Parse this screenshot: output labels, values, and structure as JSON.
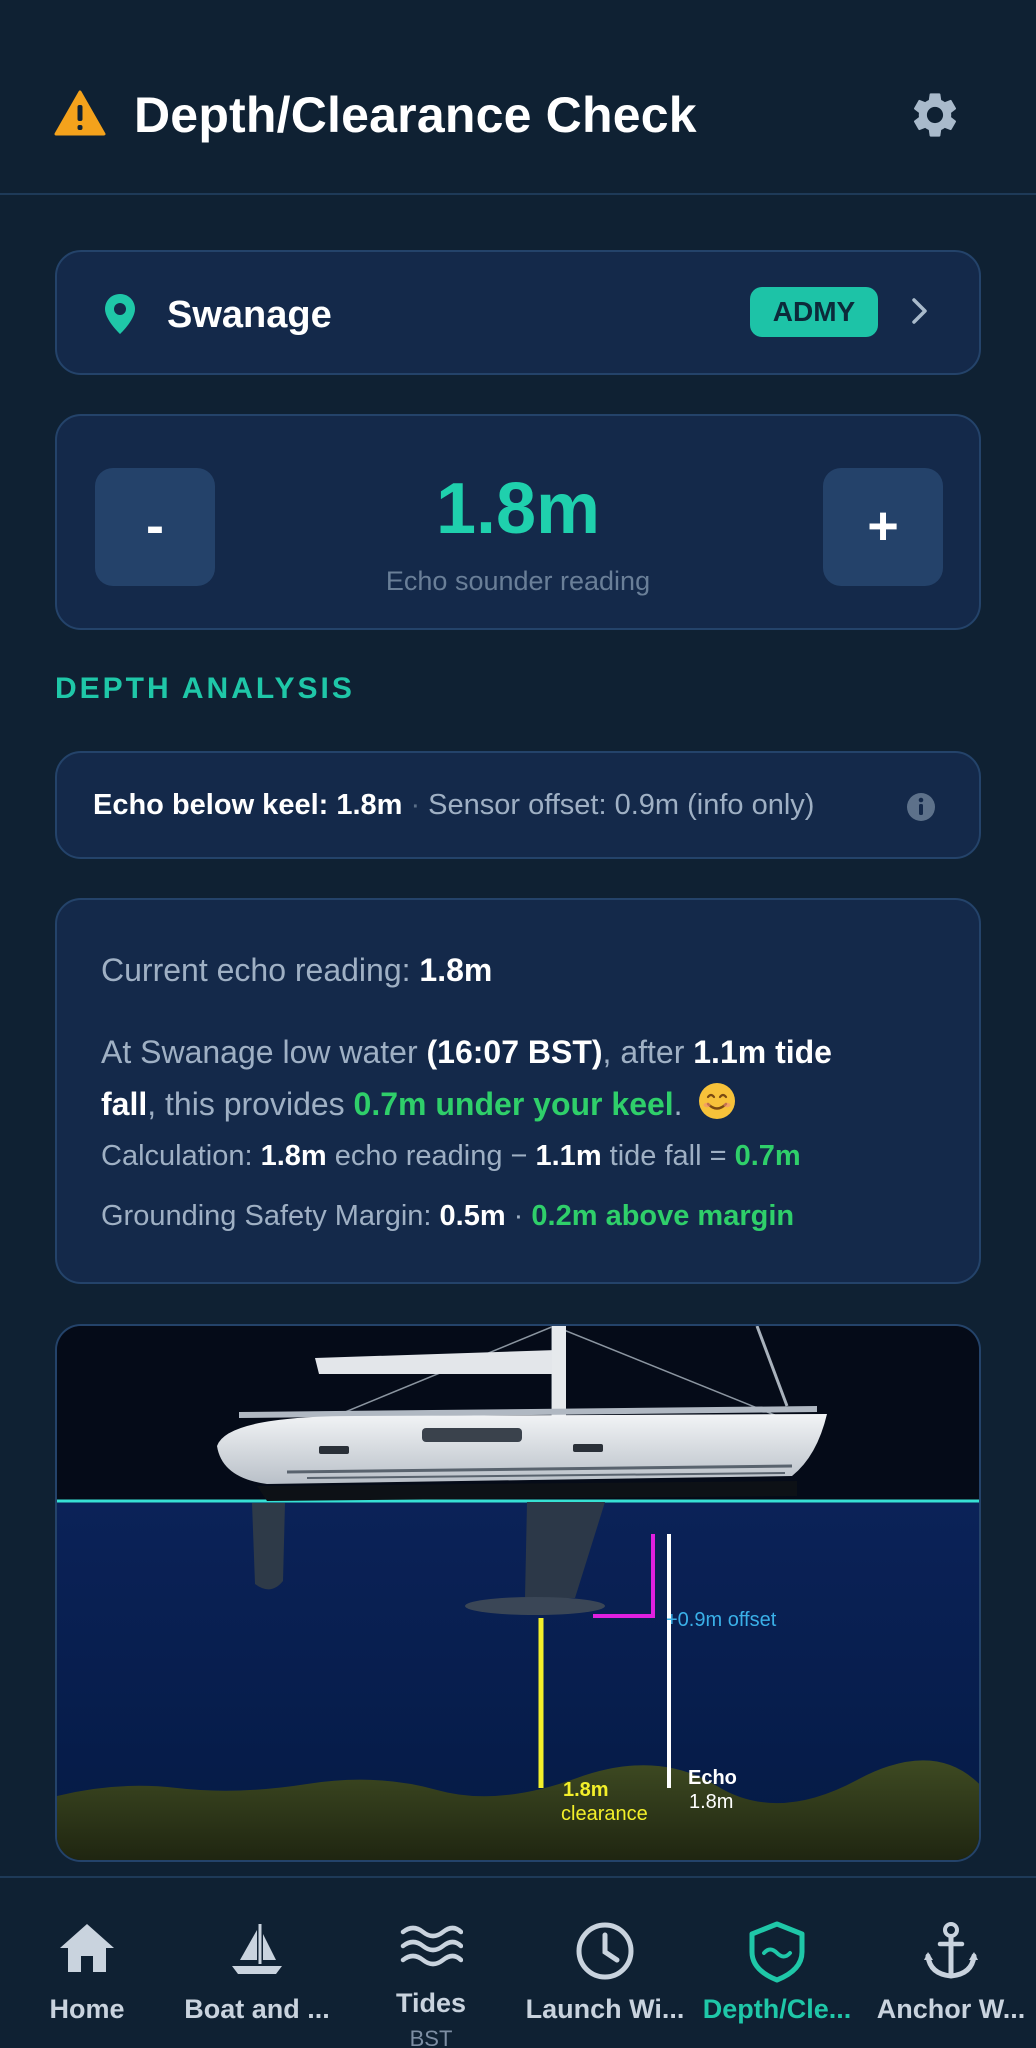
{
  "header": {
    "title": "Depth/Clearance Check",
    "warning_icon": "warning-triangle-icon",
    "settings_icon": "gear-icon"
  },
  "location": {
    "name": "Swanage",
    "badge": "ADMY"
  },
  "reading": {
    "minus_label": "-",
    "plus_label": "+",
    "value": "1.8m",
    "caption": "Echo sounder reading"
  },
  "section_title": "DEPTH ANALYSIS",
  "offset_row": {
    "echo_label": "Echo below keel: 1.8m",
    "sensor_text": "Sensor offset: 0.9m (info only)"
  },
  "analysis": {
    "current_label": "Current echo reading: ",
    "current_value": "1.8m",
    "lw_prefix": "At Swanage low water ",
    "lw_time": "(16:07 BST)",
    "lw_after": ", after ",
    "tide_fall_a": "1.1m tide",
    "tide_fall_b": "fall",
    "provides": ", this provides ",
    "under_keel": "0.7m under your keel",
    "period": ".",
    "calc_label": "Calculation: ",
    "calc_echo": "1.8m",
    "calc_echo_text": " echo reading − ",
    "calc_tide": "1.1m",
    "calc_tide_text": " tide fall = ",
    "calc_result": "0.7m",
    "margin_label": "Grounding Safety Margin: ",
    "margin_value": "0.5m",
    "margin_sep": " · ",
    "margin_status": "0.2m above margin"
  },
  "diagram": {
    "offset_label": "+0.9m offset",
    "clearance_value": "1.8m",
    "clearance_label": "clearance",
    "echo_label": "Echo",
    "echo_value": "1.8m"
  },
  "nav": {
    "items": [
      {
        "label": "Home",
        "icon": "home-icon"
      },
      {
        "label": "Boat and ...",
        "icon": "sailboat-icon"
      },
      {
        "label": "Tides",
        "sub": "BST",
        "icon": "waves-icon"
      },
      {
        "label": "Launch Wi...",
        "icon": "clock-icon"
      },
      {
        "label": "Depth/Cle...",
        "icon": "shield-wave-icon",
        "active": true
      },
      {
        "label": "Anchor W...",
        "icon": "anchor-icon"
      }
    ]
  },
  "colors": {
    "background": "#0f2133",
    "card": "#14294a",
    "accent": "#1fc7a8",
    "good": "#2fcf6a",
    "warning": "#f4a21c"
  }
}
